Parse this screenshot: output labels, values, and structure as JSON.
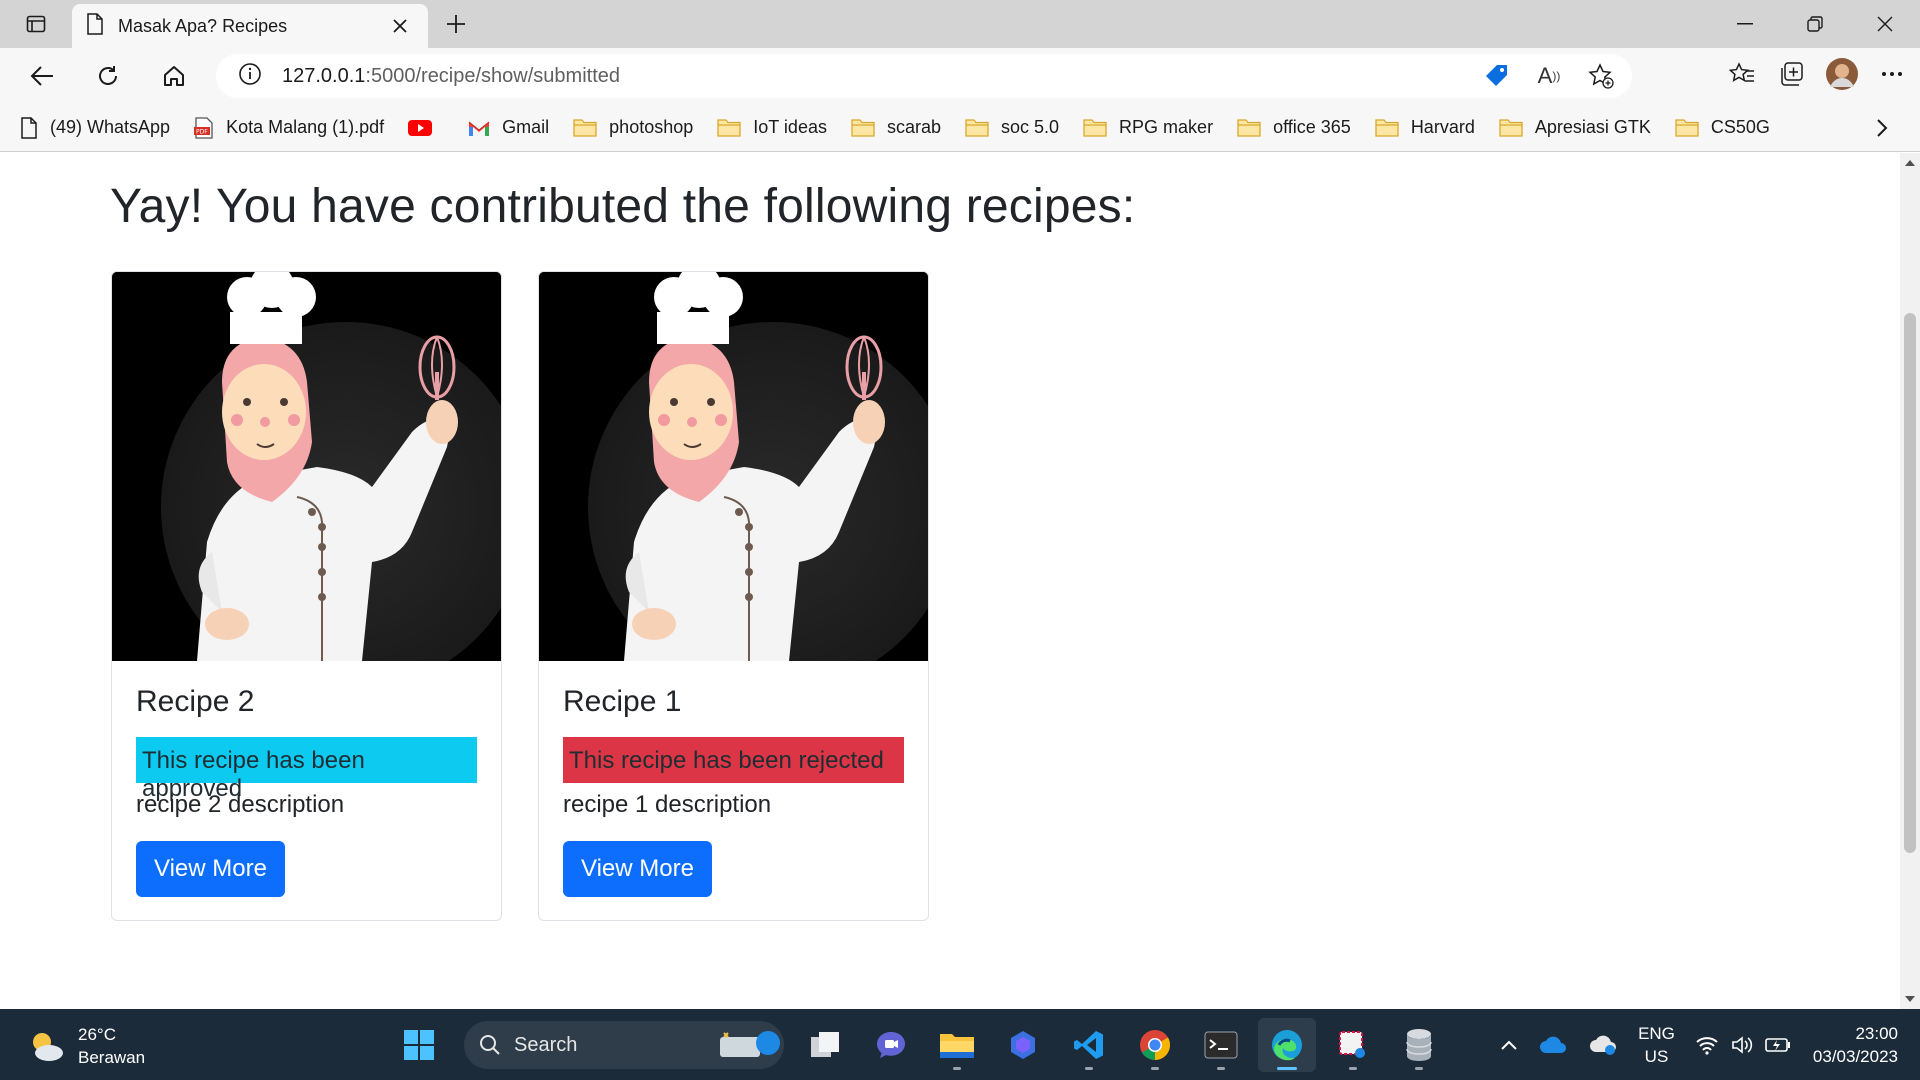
{
  "browser": {
    "tab_title": "Masak Apa? Recipes",
    "url_host": "127.0.0.1",
    "url_rest": ":5000/recipe/show/submitted"
  },
  "bookmarks": [
    {
      "label": "(49) WhatsApp",
      "icon": "page-icon"
    },
    {
      "label": "Kota Malang (1).pdf",
      "icon": "pdf-icon"
    },
    {
      "label": "",
      "icon": "youtube-icon"
    },
    {
      "label": "Gmail",
      "icon": "gmail-icon"
    },
    {
      "label": "photoshop",
      "icon": "folder-icon"
    },
    {
      "label": "IoT ideas",
      "icon": "folder-icon"
    },
    {
      "label": "scarab",
      "icon": "folder-icon"
    },
    {
      "label": "soc 5.0",
      "icon": "folder-icon"
    },
    {
      "label": "RPG maker",
      "icon": "folder-icon"
    },
    {
      "label": "office 365",
      "icon": "folder-icon"
    },
    {
      "label": "Harvard",
      "icon": "folder-icon"
    },
    {
      "label": "Apresiasi GTK",
      "icon": "folder-icon"
    },
    {
      "label": "CS50G",
      "icon": "folder-icon"
    }
  ],
  "page": {
    "heading": "Yay! You have contributed the following recipes:",
    "cards": [
      {
        "title": "Recipe 2",
        "status": "This recipe has been approved",
        "status_type": "approved",
        "description": "recipe 2 description",
        "button": "View More"
      },
      {
        "title": "Recipe 1",
        "status": "This recipe has been rejected",
        "status_type": "rejected",
        "description": "recipe 1 description",
        "button": "View More"
      }
    ]
  },
  "taskbar": {
    "temperature": "26°C",
    "weather": "Berawan",
    "search_label": "Search",
    "lang_top": "ENG",
    "lang_bottom": "US",
    "time": "23:00",
    "date": "03/03/2023"
  },
  "colors": {
    "approved": "#0dcaf0",
    "rejected": "#dc3545",
    "primary_button": "#0d6efd",
    "taskbar": "#1c2b3a"
  }
}
